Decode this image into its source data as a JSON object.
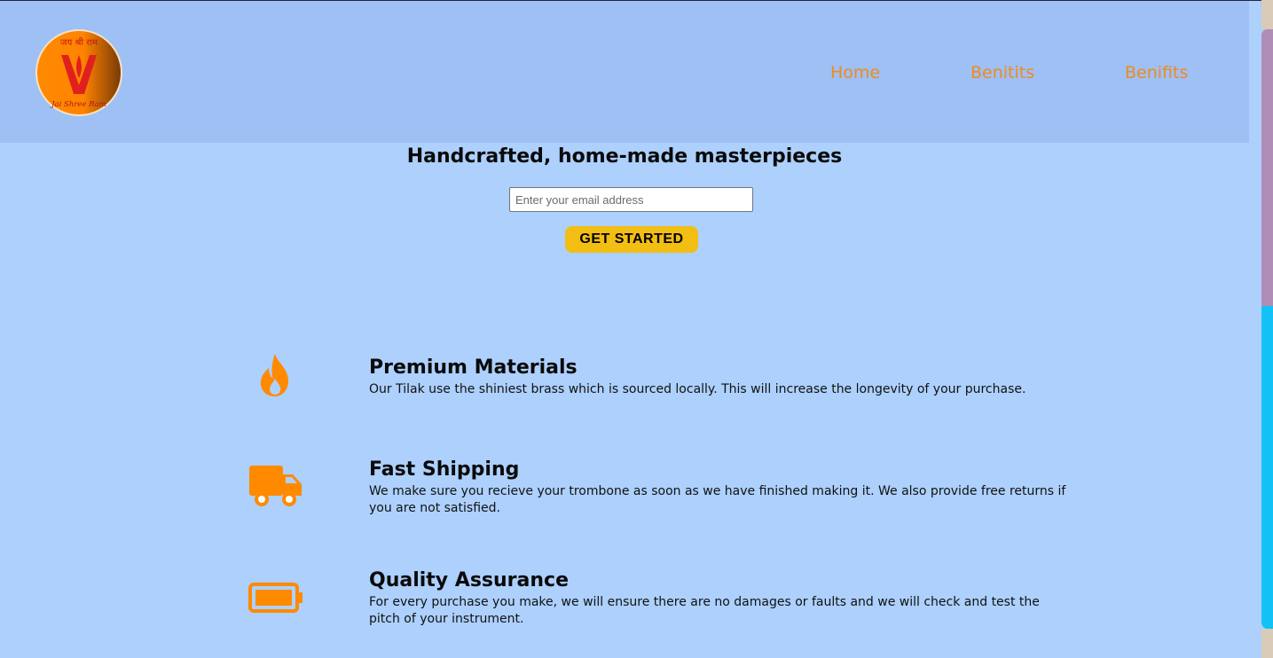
{
  "header": {
    "logo": {
      "top_text": "जय श्री राम",
      "bottom_text": "Jai Shree Ram",
      "icon": "tilak-logo-icon"
    },
    "nav": [
      {
        "label": "Home"
      },
      {
        "label": "Benitits"
      },
      {
        "label": "Benifits"
      }
    ]
  },
  "hero": {
    "title": "Handcrafted, home-made masterpieces",
    "email_placeholder": "Enter your email address",
    "email_value": "",
    "cta_label": "GET STARTED"
  },
  "features": [
    {
      "icon": "fire-icon",
      "title": "Premium Materials",
      "description": "Our Tilak use the shiniest brass which is sourced locally. This will increase the longevity of your purchase."
    },
    {
      "icon": "truck-icon",
      "title": "Fast Shipping",
      "description": "We make sure you recieve your trombone as soon as we have finished making it. We also provide free returns if you are not satisfied."
    },
    {
      "icon": "battery-icon",
      "title": "Quality Assurance",
      "description": "For every purchase you make, we will ensure there are no damages or faults and we will check and test the pitch of your instrument."
    }
  ],
  "colors": {
    "page_background": "#add0fd",
    "header_background": "#9ec0f4",
    "nav_link": "#f08a1c",
    "icon": "#ff8a00",
    "cta_background": "#f2be13",
    "scrollbar_track": "#12c2f7",
    "scrollbar_thumb": "#b08db6"
  }
}
